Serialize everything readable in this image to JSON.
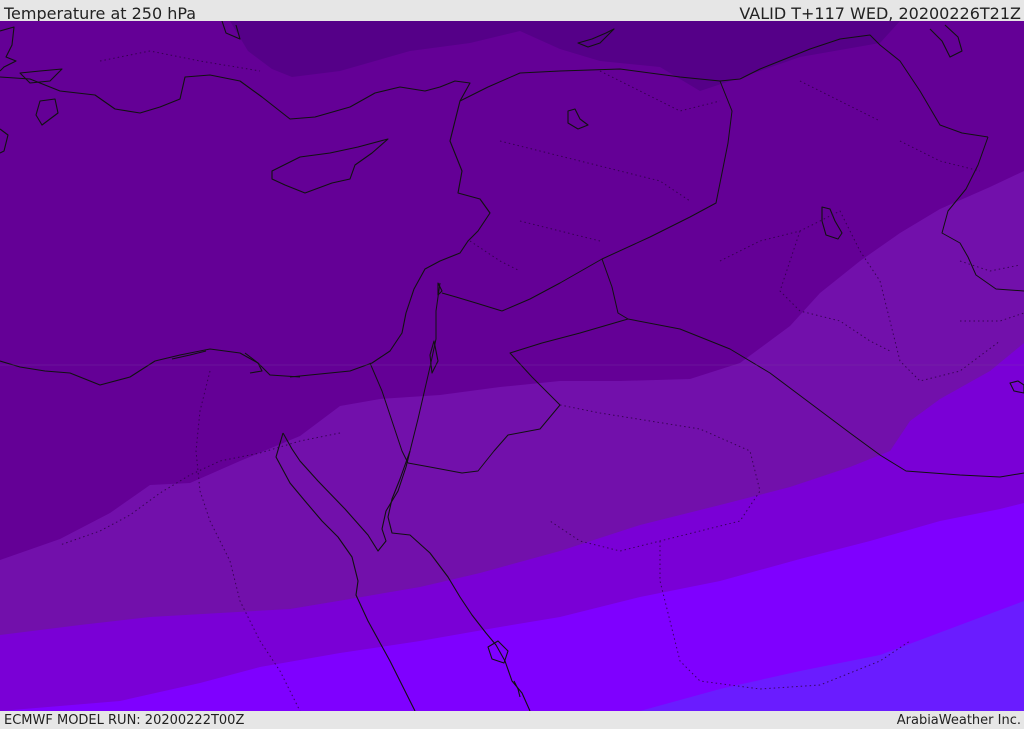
{
  "header": {
    "title": "Temperature at 250 hPa",
    "valid_time": "VALID T+117 WED, 20200226T21Z"
  },
  "footer": {
    "model_run": "ECMWF MODEL RUN: 20200222T00Z",
    "credit": "ArabiaWeather Inc."
  },
  "map": {
    "parameter": "Temperature at 250 hPa",
    "colors": {
      "band_1": "#550088",
      "band_2": "#640096",
      "band_3": "#7210ab",
      "band_4": "#7a00d6",
      "band_5": "#7f00ff",
      "band_6": "#6a1cff",
      "coastline": "#111111",
      "borders": "#111111"
    }
  }
}
